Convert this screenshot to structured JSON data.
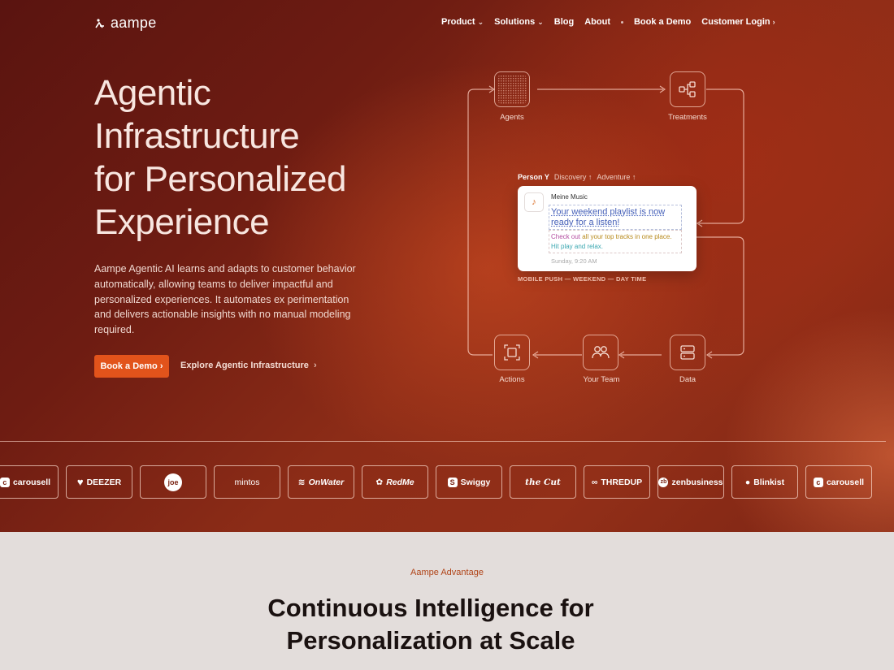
{
  "brand": {
    "name": "aampe"
  },
  "nav": {
    "items": [
      {
        "label": "Product",
        "has_dropdown": true
      },
      {
        "label": "Solutions",
        "has_dropdown": true
      },
      {
        "label": "Blog",
        "has_dropdown": false
      },
      {
        "label": "About",
        "has_dropdown": false
      }
    ],
    "demo_label": "Book a Demo",
    "login_label": "Customer Login"
  },
  "hero": {
    "headline_lines": [
      "Agentic",
      "Infrastructure",
      "for Personalized",
      "Experience"
    ],
    "subtext": "Aampe Agentic AI learns and adapts to customer behavior automatically, allowing teams to deliver impactful and personalized experiences. It automates ex perimentation and delivers actionable insights with no manual modeling required.",
    "cta_primary": "Book a Demo",
    "cta_secondary": "Explore Agentic Infrastructure"
  },
  "diagram": {
    "nodes": {
      "agents": "Agents",
      "treatments": "Treatments",
      "actions": "Actions",
      "team": "Your Team",
      "data": "Data"
    },
    "person": {
      "name": "Person Y",
      "tag1": "Discovery",
      "tag2": "Adventure"
    },
    "notification": {
      "app": "Meine Music",
      "title": "Your weekend playlist is now ready for a listen!",
      "body_part1": "Check out",
      "body_part2": "all your top tracks in one place.",
      "body_part3": "Hit play and relax.",
      "time": "Sunday, 9:20 AM"
    },
    "caption": "MOBILE PUSH — WEEKEND — DAY TIME"
  },
  "partners": [
    {
      "name": "carousell",
      "icon": "carousell-c"
    },
    {
      "name": "DEEZER",
      "icon": "heart-icon"
    },
    {
      "name": "joe",
      "icon": "circle-badge"
    },
    {
      "name": "mintos",
      "icon": ""
    },
    {
      "name": "OnWater",
      "icon": "wave-icon"
    },
    {
      "name": "RedMe",
      "icon": "flower-icon"
    },
    {
      "name": "Swiggy",
      "icon": "pin-icon"
    },
    {
      "name": "the Cut",
      "icon": ""
    },
    {
      "name": "THREDUP",
      "icon": "knot-icon"
    },
    {
      "name": "zenbusiness",
      "icon": "zb-badge"
    },
    {
      "name": "Blinkist",
      "icon": "drop-icon"
    },
    {
      "name": "carousell",
      "icon": "carousell-c"
    }
  ],
  "advantage": {
    "eyebrow": "Aampe Advantage",
    "title_line1": "Continuous Intelligence for",
    "title_line2": "Personalization at Scale"
  },
  "colors": {
    "accent": "#e2531b",
    "hero_dark": "#5a1410",
    "hero_mid": "#922f18",
    "section_bg": "#e3dddb"
  }
}
